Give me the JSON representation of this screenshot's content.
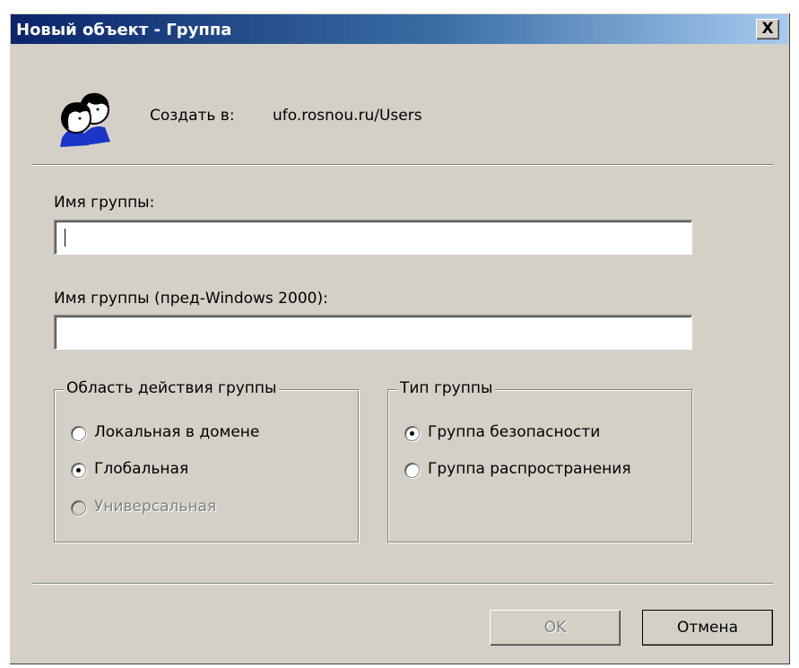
{
  "window": {
    "title": "Новый объект - Группа",
    "close_label": "X"
  },
  "header": {
    "create_in_label": "Создать в:",
    "create_in_path": "ufo.rosnou.ru/Users",
    "icon": "group-users-icon"
  },
  "group_name": {
    "label": "Имя группы:",
    "value": ""
  },
  "pre2000_name": {
    "label": "Имя группы (пред-Windows 2000):",
    "value": ""
  },
  "scope": {
    "legend": "Область действия группы",
    "options": [
      {
        "label": "Локальная в домене",
        "checked": false,
        "disabled": false
      },
      {
        "label": "Глобальная",
        "checked": true,
        "disabled": false
      },
      {
        "label": "Универсальная",
        "checked": false,
        "disabled": true
      }
    ]
  },
  "type": {
    "legend": "Тип группы",
    "options": [
      {
        "label": "Группа безопасности",
        "checked": true,
        "disabled": false
      },
      {
        "label": "Группа распространения",
        "checked": false,
        "disabled": false
      }
    ]
  },
  "buttons": {
    "ok": "OK",
    "cancel": "Отмена"
  },
  "colors": {
    "face": "#d4d0c8",
    "title_start": "#0a246a",
    "title_end": "#a6caf0"
  }
}
